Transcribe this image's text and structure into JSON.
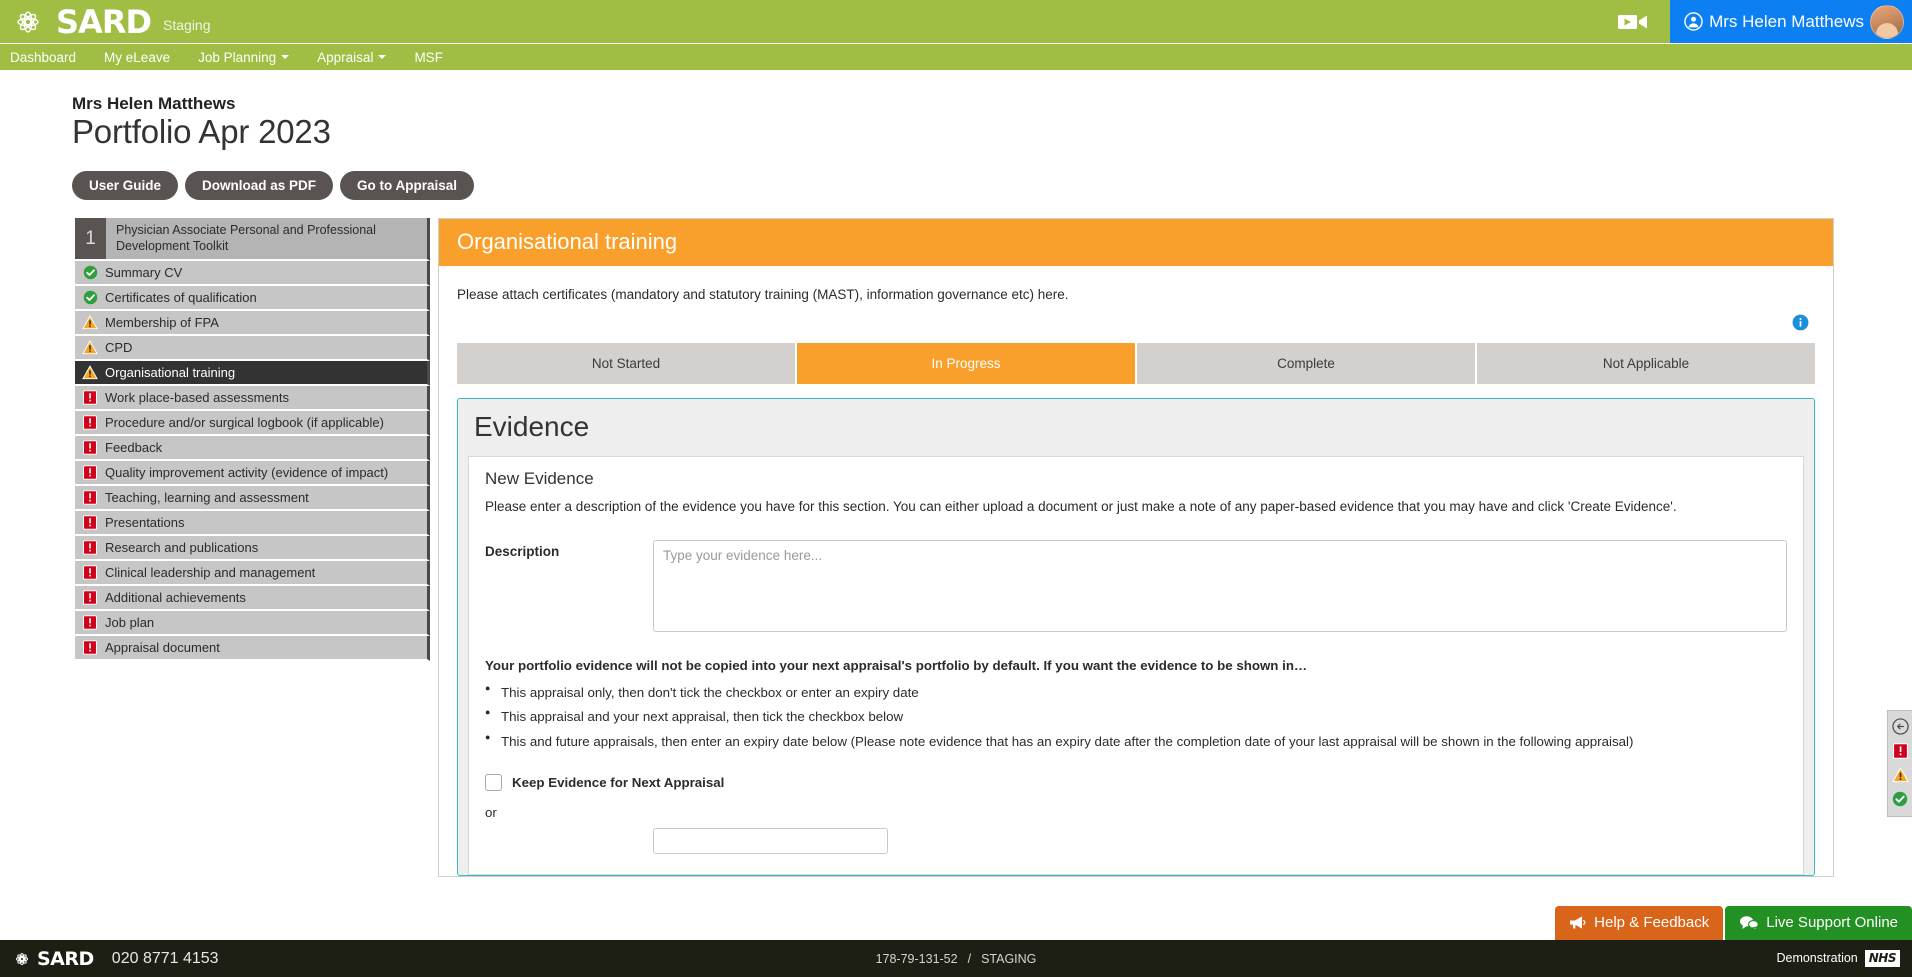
{
  "header": {
    "brand": "SARD",
    "environment": "Staging",
    "video_icon": "video-camera-icon",
    "user": {
      "name": "Mrs Helen Matthews",
      "user_icon": "user-circle-icon",
      "avatar": "user-avatar"
    }
  },
  "nav": {
    "items": [
      {
        "label": "Dashboard",
        "has_caret": false
      },
      {
        "label": "My eLeave",
        "has_caret": false
      },
      {
        "label": "Job Planning",
        "has_caret": true
      },
      {
        "label": "Appraisal",
        "has_caret": true
      },
      {
        "label": "MSF",
        "has_caret": false
      }
    ]
  },
  "page_head": {
    "person_name": "Mrs Helen Matthews",
    "title": "Portfolio Apr 2023",
    "buttons": [
      {
        "label": "User Guide"
      },
      {
        "label": "Download as PDF"
      },
      {
        "label": "Go to Appraisal"
      }
    ]
  },
  "sidebar": {
    "first": {
      "number": "1",
      "label": "Physician Associate Personal and Professional Development Toolkit"
    },
    "items": [
      {
        "label": "Summary CV",
        "status": "complete",
        "icon": "check-circle-icon",
        "active": false
      },
      {
        "label": "Certificates of qualification",
        "status": "complete",
        "icon": "check-circle-icon",
        "active": false
      },
      {
        "label": "Membership of FPA",
        "status": "warning",
        "icon": "warning-triangle-icon",
        "active": false
      },
      {
        "label": "CPD",
        "status": "warning",
        "icon": "warning-triangle-icon",
        "active": false
      },
      {
        "label": "Organisational training",
        "status": "warning",
        "icon": "warning-triangle-icon",
        "active": true
      },
      {
        "label": "Work place-based assessments",
        "status": "alert",
        "icon": "alert-square-icon",
        "active": false
      },
      {
        "label": "Procedure and/or surgical logbook (if applicable)",
        "status": "alert",
        "icon": "alert-square-icon",
        "active": false
      },
      {
        "label": "Feedback",
        "status": "alert",
        "icon": "alert-square-icon",
        "active": false
      },
      {
        "label": "Quality improvement activity (evidence of impact)",
        "status": "alert",
        "icon": "alert-square-icon",
        "active": false
      },
      {
        "label": "Teaching, learning and assessment",
        "status": "alert",
        "icon": "alert-square-icon",
        "active": false
      },
      {
        "label": "Presentations",
        "status": "alert",
        "icon": "alert-square-icon",
        "active": false
      },
      {
        "label": "Research and publications",
        "status": "alert",
        "icon": "alert-square-icon",
        "active": false
      },
      {
        "label": "Clinical leadership and management",
        "status": "alert",
        "icon": "alert-square-icon",
        "active": false
      },
      {
        "label": "Additional achievements",
        "status": "alert",
        "icon": "alert-square-icon",
        "active": false
      },
      {
        "label": "Job plan",
        "status": "alert",
        "icon": "alert-square-icon",
        "active": false
      },
      {
        "label": "Appraisal document",
        "status": "alert",
        "icon": "alert-square-icon",
        "active": false
      }
    ]
  },
  "main": {
    "section_title": "Organisational training",
    "intro": "Please attach certificates (mandatory and statutory training (MAST), information governance etc) here.",
    "info_icon": "info-circle-icon",
    "status_tabs": [
      {
        "label": "Not Started",
        "active": false
      },
      {
        "label": "In Progress",
        "active": true
      },
      {
        "label": "Complete",
        "active": false
      },
      {
        "label": "Not Applicable",
        "active": false
      }
    ],
    "evidence": {
      "title": "Evidence",
      "new_evidence_title": "New Evidence",
      "new_evidence_desc": "Please enter a description of the evidence you have for this section. You can either upload a document or just make a note of any paper-based evidence that you may have and click 'Create Evidence'.",
      "description_label": "Description",
      "description_value": "",
      "description_placeholder": "Type your evidence here...",
      "copy_note": "Your portfolio evidence will not be copied into your next appraisal's portfolio by default. If you want the evidence to be shown in…",
      "bullets": [
        "This appraisal only, then don't tick the checkbox or enter an expiry date",
        "This appraisal and your next appraisal, then tick the checkbox below",
        "This and future appraisals, then enter an expiry date below (Please note evidence that has an expiry date after the completion date of your last appraisal will be shown in the following appraisal)"
      ],
      "keep_checkbox_label": "Keep Evidence for Next Appraisal",
      "keep_checkbox_checked": false,
      "or_text": "or"
    }
  },
  "legend_widget": {
    "items": [
      {
        "icon": "back-arrow-circle-icon",
        "name": "collapse-panel"
      },
      {
        "icon": "alert-square-icon",
        "name": "legend-alert"
      },
      {
        "icon": "warning-triangle-icon",
        "name": "legend-warning"
      },
      {
        "icon": "check-circle-icon",
        "name": "legend-complete"
      }
    ]
  },
  "support": {
    "help_label": "Help & Feedback",
    "help_icon": "megaphone-icon",
    "live_label": "Live Support Online",
    "live_icon": "chat-bubble-icon"
  },
  "footer": {
    "brand": "SARD",
    "phone": "020 8771 4153",
    "build": "178-79-131-52",
    "separator": "/",
    "environment": "STAGING",
    "demo_label": "Demonstration",
    "nhs_logo": "NHS"
  },
  "colors": {
    "brand_green": "#9fbe43",
    "accent_orange": "#f9a02c",
    "user_blue": "#0c7ff2",
    "help_orange": "#d9651b",
    "live_green": "#239023",
    "dark_footer": "#1d1e14"
  }
}
